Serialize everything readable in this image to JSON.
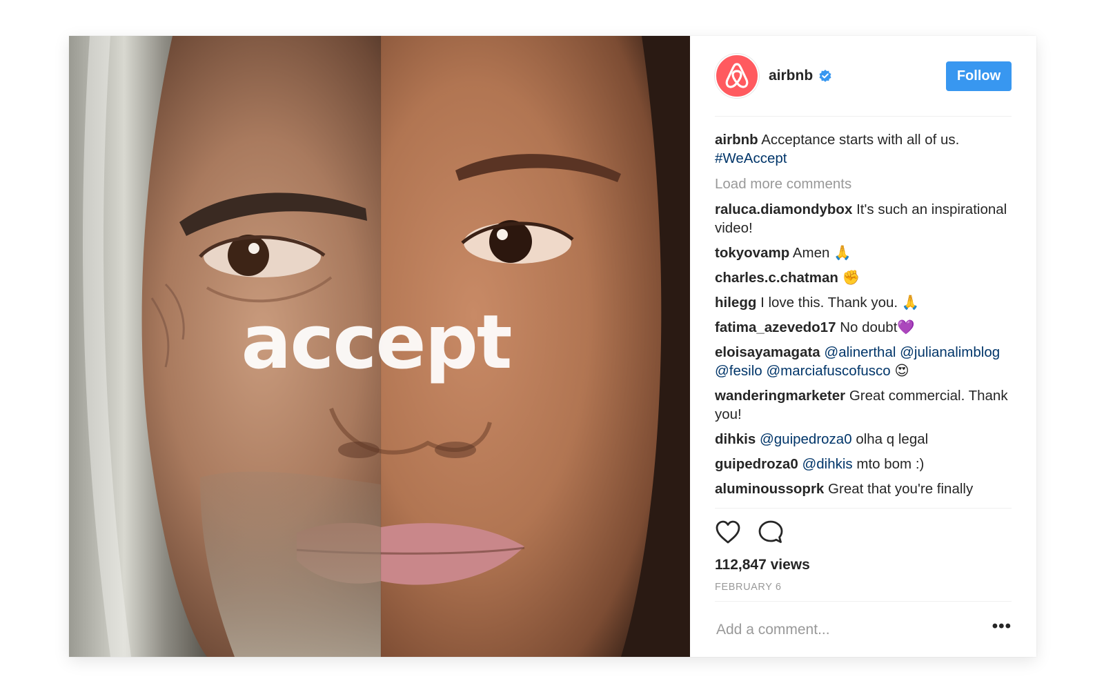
{
  "media": {
    "overlay_text": "accept"
  },
  "header": {
    "username": "airbnb",
    "verified_icon": "verified-badge-icon",
    "follow_label": "Follow",
    "brand_color": "#ff5a5f",
    "accent_color": "#3897f0"
  },
  "caption": {
    "username": "airbnb",
    "text": "Acceptance starts with all of us.",
    "hashtag": "#WeAccept"
  },
  "load_more": "Load more comments",
  "comments": [
    {
      "user": "raluca.diamondybox",
      "parts": [
        {
          "t": "text",
          "v": "It's such an inspirational video!"
        }
      ]
    },
    {
      "user": "tokyovamp",
      "parts": [
        {
          "t": "text",
          "v": "Amen 🙏"
        }
      ]
    },
    {
      "user": "charles.c.chatman",
      "parts": [
        {
          "t": "text",
          "v": "✊"
        }
      ]
    },
    {
      "user": "hilegg",
      "parts": [
        {
          "t": "text",
          "v": "I love this. Thank you. 🙏"
        }
      ]
    },
    {
      "user": "fatima_azevedo17",
      "parts": [
        {
          "t": "text",
          "v": "No doubt💜"
        }
      ]
    },
    {
      "user": "eloisayamagata",
      "parts": [
        {
          "t": "mention",
          "v": "@alinerthal"
        },
        {
          "t": "mention",
          "v": "@julianalimblog"
        },
        {
          "t": "mention",
          "v": "@fesilo"
        },
        {
          "t": "mention",
          "v": "@marciafuscofusco"
        },
        {
          "t": "text",
          "v": "😍"
        }
      ]
    },
    {
      "user": "wanderingmarketer",
      "parts": [
        {
          "t": "text",
          "v": "Great commercial. Thank you!"
        }
      ]
    },
    {
      "user": "dihkis",
      "parts": [
        {
          "t": "mention",
          "v": "@guipedroza0"
        },
        {
          "t": "text",
          "v": "olha q legal"
        }
      ]
    },
    {
      "user": "guipedroza0",
      "parts": [
        {
          "t": "mention",
          "v": "@dihkis"
        },
        {
          "t": "text",
          "v": "mto bom :)"
        }
      ]
    },
    {
      "user": "aluminoussoprk",
      "parts": [
        {
          "t": "text",
          "v": "Great that you're finally"
        }
      ]
    }
  ],
  "actions": {
    "like_icon": "heart-icon",
    "comment_icon": "comment-bubble-icon"
  },
  "views": "112,847 views",
  "date": "FEBRUARY 6",
  "add_comment": {
    "placeholder": "Add a comment...",
    "more_label": "•••"
  }
}
